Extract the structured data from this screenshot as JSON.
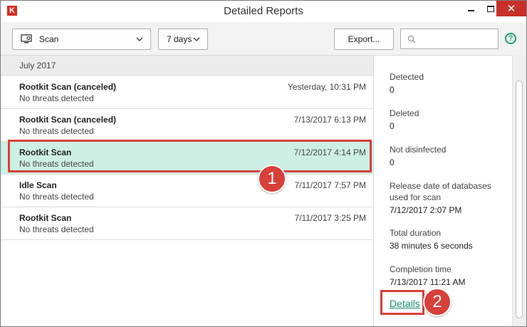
{
  "window": {
    "title": "Detailed Reports",
    "logo_letter": "K",
    "close_glyph": "✕"
  },
  "toolbar": {
    "scan_select_value": "Scan",
    "days_select_value": "7 days",
    "export_label": "Export...",
    "search_placeholder": "",
    "help_glyph": "?"
  },
  "list": {
    "group_label": "July 2017",
    "rows": [
      {
        "name": "Rootkit Scan (canceled)",
        "status": "No threats detected",
        "date": "Yesterday, 10:31 PM"
      },
      {
        "name": "Rootkit Scan (canceled)",
        "status": "No threats detected",
        "date": "7/13/2017 6:13 PM"
      },
      {
        "name": "Rootkit Scan",
        "status": "No threats detected",
        "date": "7/12/2017 4:14 PM"
      },
      {
        "name": "Idle Scan",
        "status": "No threats detected",
        "date": "7/11/2017 7:57 PM"
      },
      {
        "name": "Rootkit Scan",
        "status": "No threats detected",
        "date": "7/11/2017 3:25 PM"
      }
    ]
  },
  "details": {
    "detected_label": "Detected",
    "detected_value": "0",
    "deleted_label": "Deleted",
    "deleted_value": "0",
    "not_disinfected_label": "Not disinfected",
    "not_disinfected_value": "0",
    "release_label": "Release date of databases used for scan",
    "release_value": "7/12/2017 2:07 PM",
    "duration_label": "Total duration",
    "duration_value": "38 minutes 6 seconds",
    "completion_label": "Completion time",
    "completion_value": "7/13/2017 11:21 AM",
    "link_label": "Details"
  },
  "annotations": {
    "callout_1": "1",
    "callout_2": "2",
    "color": "#d8403a"
  },
  "colors": {
    "accent_green": "#1aa370",
    "selected_row": "#cdf0e4",
    "close_button": "#c7312a"
  }
}
